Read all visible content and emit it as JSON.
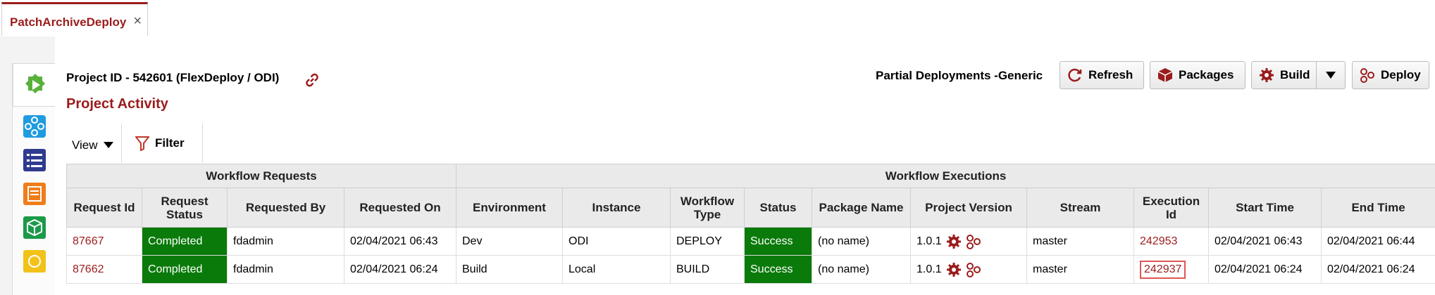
{
  "tab": {
    "label": "PatchArchiveDeploy",
    "close": "×"
  },
  "header": {
    "project_title": "Project ID - 542601 (FlexDeploy / ODI)",
    "section_title": "Project Activity",
    "partial_label": "Partial Deployments -Generic"
  },
  "toolbar": {
    "refresh": "Refresh",
    "packages": "Packages",
    "build": "Build",
    "deploy": "Deploy"
  },
  "view_bar": {
    "view": "View",
    "filter": "Filter"
  },
  "table": {
    "groups": [
      "Workflow Requests",
      "Workflow Executions"
    ],
    "columns": [
      "Request Id",
      "Request Status",
      "Requested By",
      "Requested On",
      "Environment",
      "Instance",
      "Workflow Type",
      "Status",
      "Package Name",
      "Project Version",
      "Stream",
      "Execution Id",
      "Start Time",
      "End Time"
    ],
    "rows": [
      {
        "request_id": "87667",
        "request_status": "Completed",
        "requested_by": "fdadmin",
        "requested_on": "02/04/2021 06:43",
        "environment": "Dev",
        "instance": "ODI",
        "workflow_type": "DEPLOY",
        "status": "Success",
        "package_name": "(no name)",
        "project_version": "1.0.1",
        "stream": "master",
        "execution_id": "242953",
        "start_time": "02/04/2021 06:43",
        "end_time": "02/04/2021 06:44"
      },
      {
        "request_id": "87662",
        "request_status": "Completed",
        "requested_by": "fdadmin",
        "requested_on": "02/04/2021 06:24",
        "environment": "Build",
        "instance": "Local",
        "workflow_type": "BUILD",
        "status": "Success",
        "package_name": "(no name)",
        "project_version": "1.0.1",
        "stream": "master",
        "execution_id": "242937",
        "start_time": "02/04/2021 06:24",
        "end_time": "02/04/2021 06:24"
      }
    ]
  },
  "colors": {
    "brand": "#9b1c1c",
    "success": "#0a7a0a"
  }
}
